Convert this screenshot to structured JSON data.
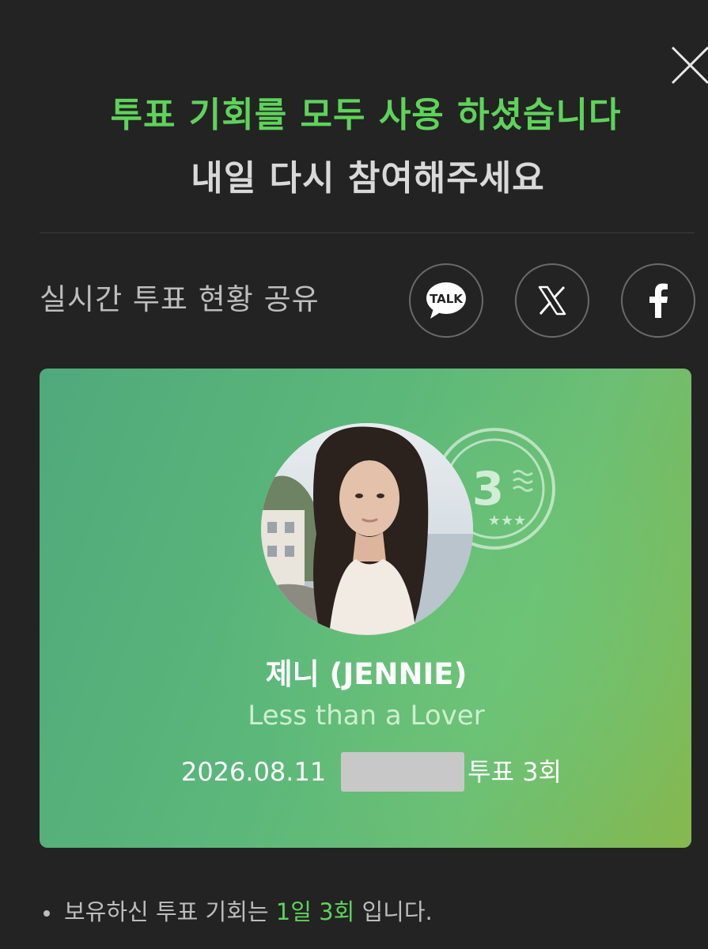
{
  "header": {
    "title": "투표 기회를 모두 사용 하셨습니다",
    "subtitle": "내일 다시 참여해주세요"
  },
  "share": {
    "label": "실시간 투표 현황 공유",
    "kakao_label": "TALK"
  },
  "card": {
    "stamp_number": "3",
    "artist": "제니 (JENNIE)",
    "song": "Less than a Lover",
    "date": "2026.08.11",
    "vote_text": "투표 3회"
  },
  "note": {
    "prefix": "보유하신 투표 기회는 ",
    "highlight": "1일 3회",
    "suffix": " 입니다."
  },
  "colors": {
    "accent_green": "#5ed35a",
    "background": "#232323"
  },
  "icons": [
    "close-icon",
    "kakaotalk-icon",
    "x-logo-icon",
    "facebook-icon"
  ]
}
